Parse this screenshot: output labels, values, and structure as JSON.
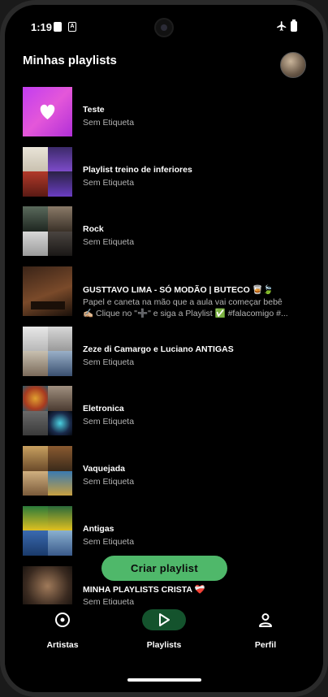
{
  "status_bar": {
    "time": "1:19",
    "badge": "A"
  },
  "header": {
    "title": "Minhas playlists"
  },
  "playlists": [
    {
      "title": "Teste",
      "subtitle": "Sem Etiqueta"
    },
    {
      "title": "Playlist treino de inferiores",
      "subtitle": "Sem Etiqueta"
    },
    {
      "title": "Rock",
      "subtitle": "Sem Etiqueta"
    },
    {
      "title": "GUSTTAVO LIMA - SÓ MODÃO | BUTECO 🥃🍃",
      "subtitle": "Papel e caneta na mão que a aula vai começar bebê ✍🏼 Clique no \"➕\" e siga a Playlist ✅ #falacomigo #..."
    },
    {
      "title": "Zeze di Camargo e Luciano ANTIGAS",
      "subtitle": "Sem Etiqueta"
    },
    {
      "title": "Eletronica",
      "subtitle": "Sem Etiqueta"
    },
    {
      "title": "Vaquejada",
      "subtitle": "Sem Etiqueta"
    },
    {
      "title": "Antigas",
      "subtitle": "Sem Etiqueta"
    },
    {
      "title": "MINHA PLAYLISTS CRISTA ❤️‍🩹",
      "subtitle": "Sem Etiqueta"
    }
  ],
  "fab": {
    "label": "Criar playlist"
  },
  "bottom_nav": [
    {
      "label": "Artistas",
      "icon": "album-icon"
    },
    {
      "label": "Playlists",
      "icon": "play-icon",
      "active": true
    },
    {
      "label": "Perfil",
      "icon": "person-icon"
    }
  ],
  "colors": {
    "accent": "#4fb86a",
    "active_pill": "#14532d",
    "background": "#000000",
    "subtext": "#b3b3b3"
  }
}
